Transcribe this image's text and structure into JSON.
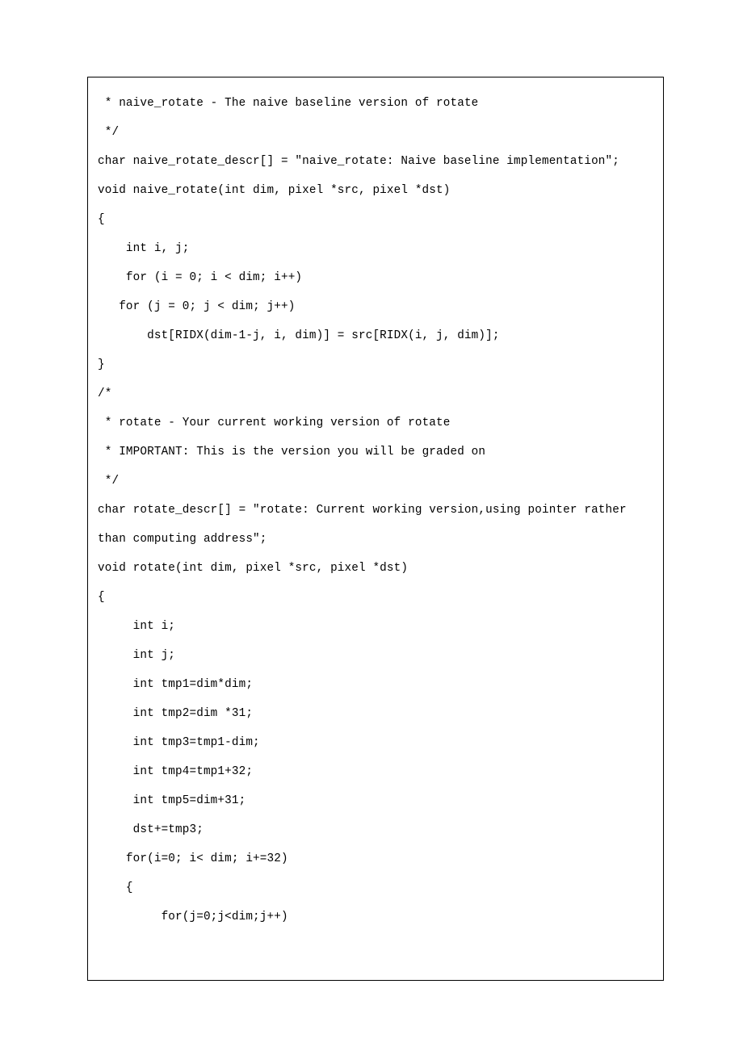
{
  "code": {
    "lines": [
      " * naive_rotate - The naive baseline version of rotate",
      " */",
      "char naive_rotate_descr[] = \"naive_rotate: Naive baseline implementation\";",
      "void naive_rotate(int dim, pixel *src, pixel *dst)",
      "{",
      "    int i, j;",
      "    for (i = 0; i < dim; i++)",
      "   for (j = 0; j < dim; j++)",
      "       dst[RIDX(dim-1-j, i, dim)] = src[RIDX(i, j, dim)];",
      "}",
      "/*",
      " * rotate - Your current working version of rotate",
      " * IMPORTANT: This is the version you will be graded on",
      " */",
      "char rotate_descr[] = \"rotate: Current working version,using pointer rather than computing address\";",
      "void rotate(int dim, pixel *src, pixel *dst)",
      "{",
      "     int i;",
      "     int j;",
      "     int tmp1=dim*dim;",
      "     int tmp2=dim *31;",
      "     int tmp3=tmp1-dim;",
      "     int tmp4=tmp1+32;",
      "     int tmp5=dim+31;",
      "     dst+=tmp3;",
      "",
      "    for(i=0; i< dim; i+=32)",
      "    {",
      "         for(j=0;j<dim;j++)"
    ]
  }
}
